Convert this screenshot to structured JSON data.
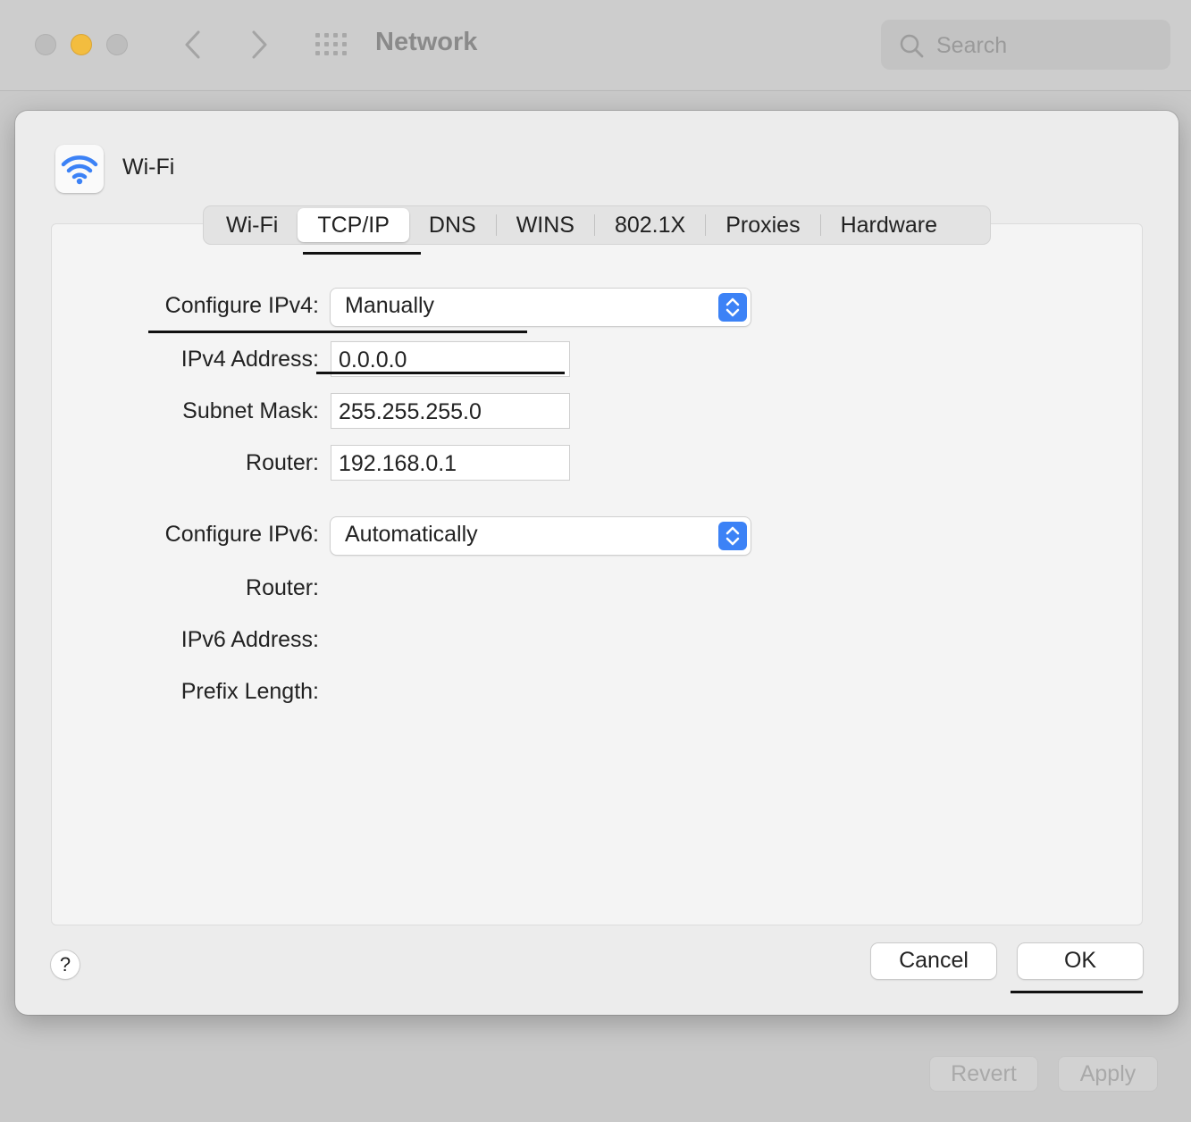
{
  "window": {
    "title": "Network",
    "search_placeholder": "Search"
  },
  "footer": {
    "revert_label": "Revert",
    "apply_label": "Apply"
  },
  "sheet": {
    "service_name": "Wi-Fi",
    "service_icon": "wifi-icon",
    "tabs": [
      {
        "label": "Wi-Fi",
        "active": false
      },
      {
        "label": "TCP/IP",
        "active": true
      },
      {
        "label": "DNS",
        "active": false
      },
      {
        "label": "WINS",
        "active": false
      },
      {
        "label": "802.1X",
        "active": false
      },
      {
        "label": "Proxies",
        "active": false
      },
      {
        "label": "Hardware",
        "active": false
      }
    ],
    "ipv4": {
      "configure_label": "Configure IPv4:",
      "configure_value": "Manually",
      "address_label": "IPv4 Address:",
      "address_value": "0.0.0.0",
      "subnet_label": "Subnet Mask:",
      "subnet_value": "255.255.255.0",
      "router_label": "Router:",
      "router_value": "192.168.0.1"
    },
    "ipv6": {
      "configure_label": "Configure IPv6:",
      "configure_value": "Automatically",
      "router_label": "Router:",
      "address_label": "IPv6 Address:",
      "prefix_label": "Prefix Length:"
    },
    "help_label": "?",
    "cancel_label": "Cancel",
    "ok_label": "OK"
  },
  "colors": {
    "accent": "#3c82f6",
    "minimize": "#f3bd3f"
  }
}
